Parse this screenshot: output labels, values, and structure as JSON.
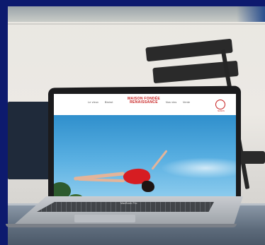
{
  "website": {
    "nav_left": [
      "Le vieux",
      "Bistrot"
    ],
    "brand_line1": "MAISON FONDÉE",
    "brand_line2": "RENAISSANCE",
    "nav_right": [
      "Nos vins",
      "Vente"
    ],
    "seal_text": "MAISON"
  },
  "laptop": {
    "model_label": "MacBook Pro"
  },
  "colors": {
    "frame": "#0d1a6e",
    "brand_red": "#c61d1d",
    "sky": "#3a97d2",
    "dress": "#d61d22"
  }
}
